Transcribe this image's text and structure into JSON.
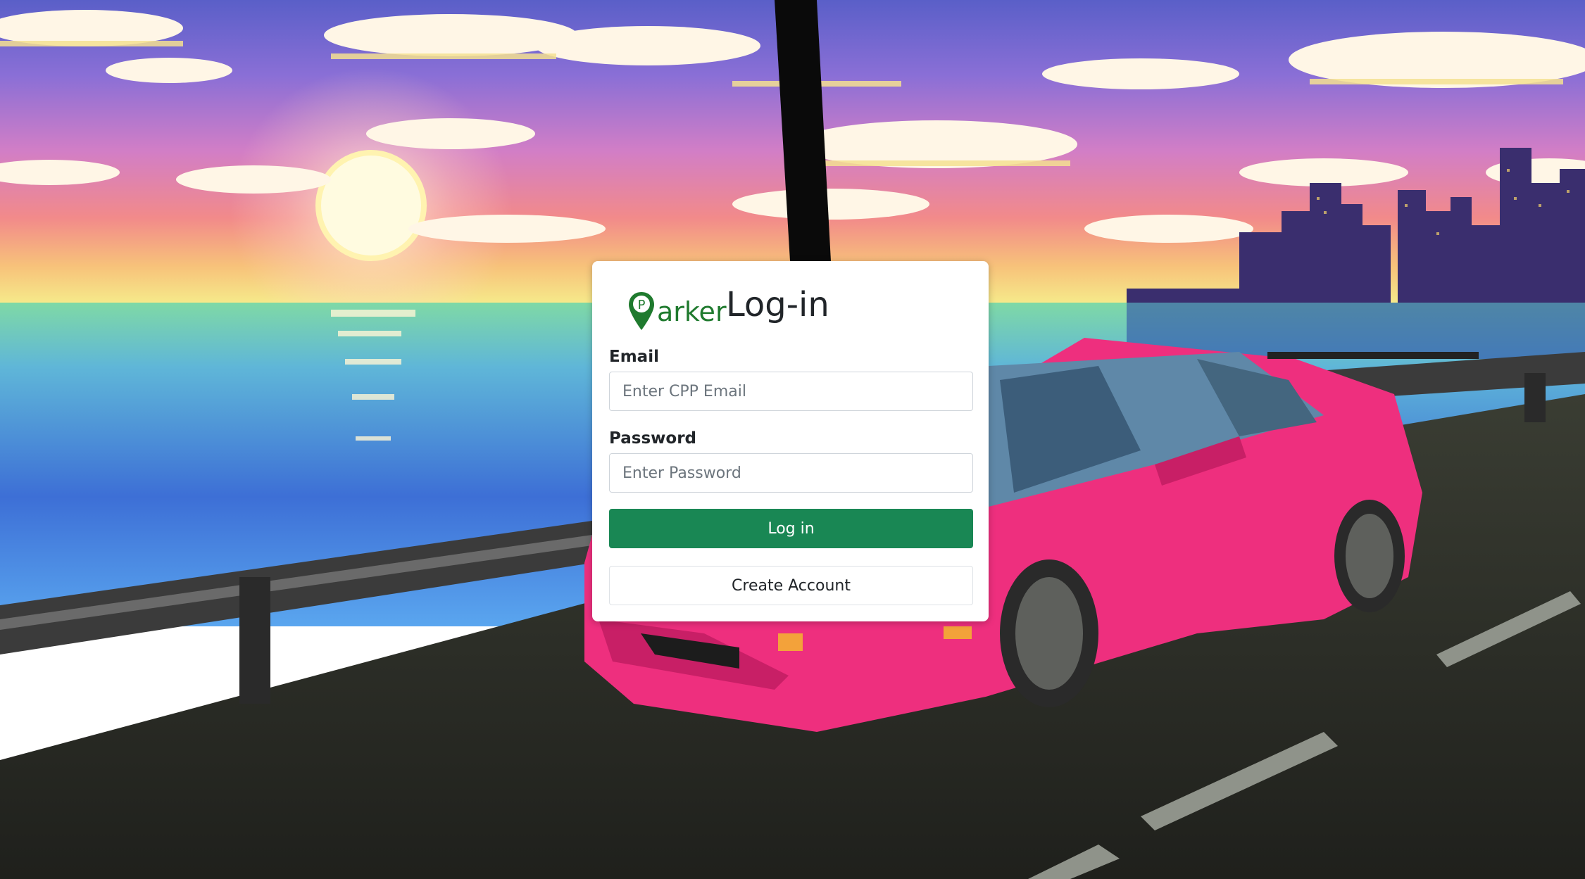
{
  "brand": {
    "pin_letter": "P",
    "name": "arker",
    "color": "#1f7a2e"
  },
  "login": {
    "title": "Log-in",
    "email_label": "Email",
    "email_placeholder": "Enter CPP Email",
    "password_label": "Password",
    "password_placeholder": "Enter Password",
    "login_button": "Log in",
    "create_account_button": "Create Account"
  },
  "colors": {
    "primary_button": "#198754"
  }
}
